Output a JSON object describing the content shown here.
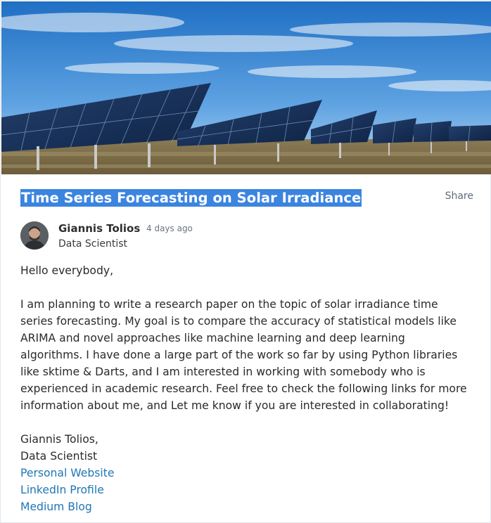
{
  "post": {
    "title": "Time Series Forecasting on Solar Irradiance",
    "share_label": "Share"
  },
  "author": {
    "name": "Giannis Tolios",
    "role": "Data Scientist",
    "posted": "4 days ago"
  },
  "body": {
    "greeting": "Hello everybody,",
    "paragraph": "I am planning to write a research paper on the topic of solar irradiance time series forecasting. My goal is to compare the accuracy of statistical models like ARIMA and novel approaches like machine learning and deep learning algorithms. I have done a large part of the work so far by using Python libraries like sktime & Darts, and I am interested in working with somebody who is experienced in academic research. Feel free to check the following links for more information about me, and Let me know if you are interested in collaborating!",
    "signature_name": "Giannis Tolios,",
    "signature_role": "Data Scientist"
  },
  "links": [
    {
      "label": "Personal Website"
    },
    {
      "label": "LinkedIn Profile"
    },
    {
      "label": "Medium Blog"
    }
  ],
  "colors": {
    "title_highlight": "#3b84e0",
    "link": "#1f77b4",
    "sky": "#2f7fd1"
  }
}
